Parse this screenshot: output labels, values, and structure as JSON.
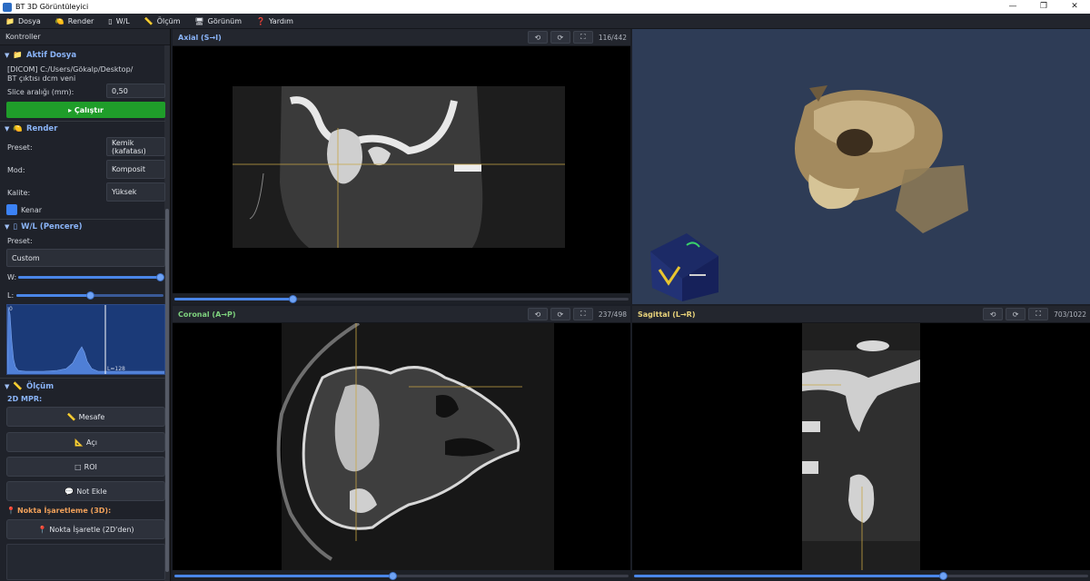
{
  "window": {
    "title": "BT 3D Görüntüleyici",
    "minimize": "—",
    "restore": "❐",
    "close": "✕"
  },
  "menu": [
    {
      "icon": "📁",
      "label": "Dosya"
    },
    {
      "icon": "🍋",
      "label": "Render"
    },
    {
      "icon": "▯",
      "label": "W/L"
    },
    {
      "icon": "📏",
      "label": "Ölçüm"
    },
    {
      "icon": "🖥",
      "label": "Görünüm"
    },
    {
      "icon": "❓",
      "label": "Yardım"
    }
  ],
  "sidebar": {
    "header": "Kontroller",
    "active_file": {
      "title": "Aktif Dosya",
      "path_line1": "[DICOM] C:/Users/Gökalp/Desktop/",
      "path_line2": "BT çıktısı dcm veni",
      "slice_label": "Slice aralığı (mm):",
      "slice_value": "0,50",
      "run_label": "▸ Çalıştır"
    },
    "render": {
      "title": "Render",
      "preset_label": "Preset:",
      "preset_value": "Kemik (kafatası)",
      "mode_label": "Mod:",
      "mode_value": "Komposit",
      "quality_label": "Kalite:",
      "quality_value": "Yüksek",
      "edge_label": "Kenar",
      "edge_checked": true
    },
    "wl": {
      "title": "W/L (Pencere)",
      "preset_label": "Preset:",
      "preset_value": "Custom",
      "w_label": "W:",
      "w_level": 0.99,
      "l_label": "L:",
      "l_level": 0.5,
      "hist_left": "0",
      "hist_right": "L=128"
    },
    "measure": {
      "title": "Ölçüm",
      "mpr_label": "2D MPR:",
      "buttons": [
        {
          "icon": "📏",
          "label": "Mesafe"
        },
        {
          "icon": "📐",
          "label": "Açı"
        },
        {
          "icon": "□",
          "label": "ROI"
        },
        {
          "icon": "💬",
          "label": "Not Ekle"
        }
      ],
      "point_title": "Nokta İşaretleme (3D):",
      "point_button": "Nokta İşaretle (2D'den)"
    }
  },
  "viewports": {
    "axial": {
      "title": "Axial (S→I)",
      "count": "116/442",
      "slider": 0.26
    },
    "coronal": {
      "title": "Coronal (A→P)",
      "count": "237/498",
      "slider": 0.48
    },
    "sagittal": {
      "title": "Sagittal (L→R)",
      "count": "703/1022",
      "slider": 0.68
    }
  },
  "tool_icons": {
    "rotate_left": "⟲",
    "rotate_right": "⟳",
    "fullscreen": "⛶"
  },
  "colors": {
    "accent": "#8ab4f8",
    "run": "#1f9d2a",
    "slider": "#4a86e8",
    "bg3d": "#2e3c56"
  }
}
